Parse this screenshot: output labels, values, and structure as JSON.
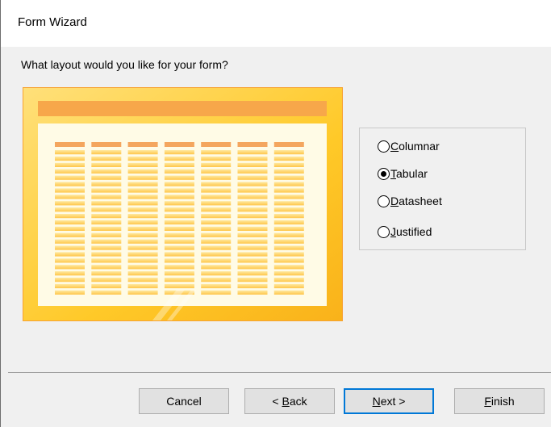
{
  "window": {
    "title": "Form Wizard"
  },
  "prompt": {
    "question": "What layout would you like for your form?"
  },
  "layout_options": [
    {
      "pre": "",
      "accel": "C",
      "post": "olumnar",
      "selected": false
    },
    {
      "pre": "",
      "accel": "T",
      "post": "abular",
      "selected": true
    },
    {
      "pre": "",
      "accel": "D",
      "post": "atasheet",
      "selected": false
    },
    {
      "pre": "",
      "accel": "J",
      "post": "ustified",
      "selected": false
    }
  ],
  "buttons": {
    "cancel": {
      "pre": "Cancel",
      "accel": "",
      "post": ""
    },
    "back": {
      "pre": "< ",
      "accel": "B",
      "post": "ack"
    },
    "next": {
      "pre": "",
      "accel": "N",
      "post": "ext >"
    },
    "finish": {
      "pre": "",
      "accel": "F",
      "post": "inish"
    }
  },
  "colors": {
    "preview_header": "#f7a74a",
    "preview_frame": "#ffcf3a",
    "preview_canvas": "#fffbe6",
    "column_header": "#f4a65f",
    "cell": "#ffd66b",
    "focus_border": "#0078d7"
  }
}
